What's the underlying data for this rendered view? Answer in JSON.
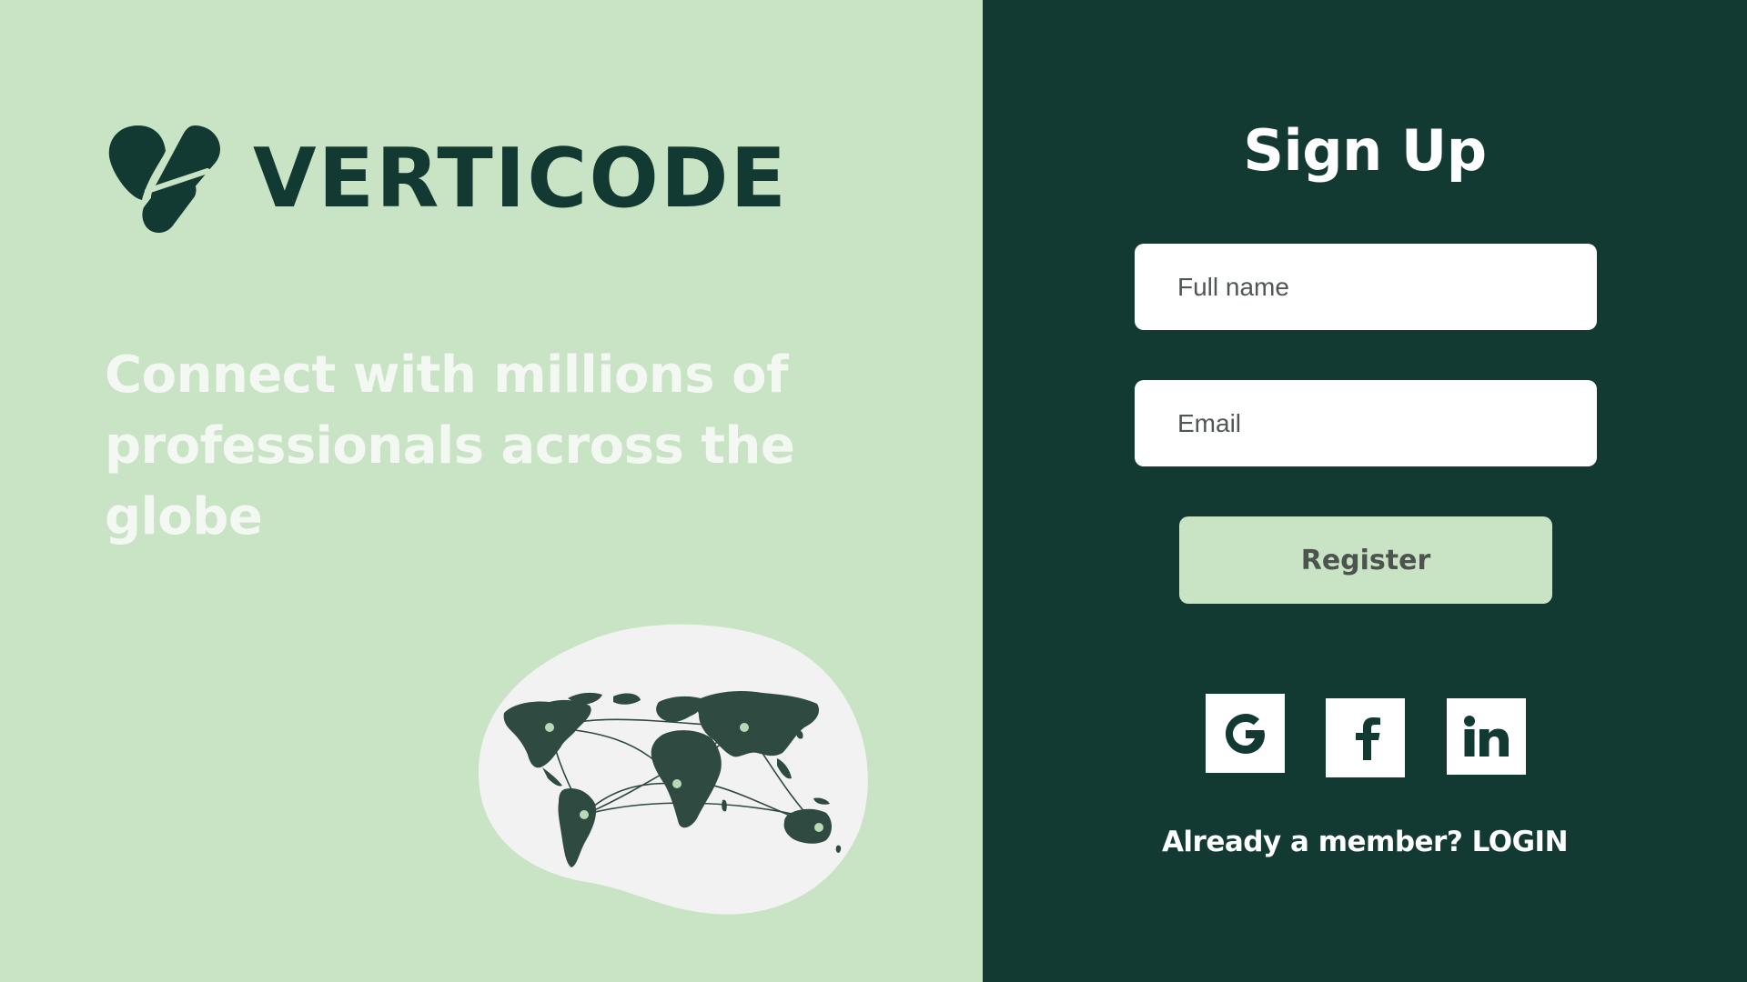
{
  "brand": {
    "name": "VERTICODE",
    "color": "#133a32"
  },
  "hero": {
    "tagline_line1": "Connect with millions of",
    "tagline_line2": "professionals across the globe",
    "illustration": "world-map-network-icon"
  },
  "signup": {
    "title": "Sign Up",
    "full_name_placeholder": "Full name",
    "full_name_value": "",
    "email_placeholder": "Email",
    "email_value": "",
    "register_label": "Register",
    "social": [
      {
        "name": "google",
        "icon": "google-icon"
      },
      {
        "name": "facebook",
        "icon": "facebook-icon"
      },
      {
        "name": "linkedin",
        "icon": "linkedin-icon"
      }
    ],
    "login_prompt": "Already a member?",
    "login_label": "LOGIN"
  },
  "colors": {
    "left_background": "#c9e4c5",
    "right_background": "#133a32",
    "accent": "#c9e4c5",
    "field_background": "#ffffff"
  }
}
